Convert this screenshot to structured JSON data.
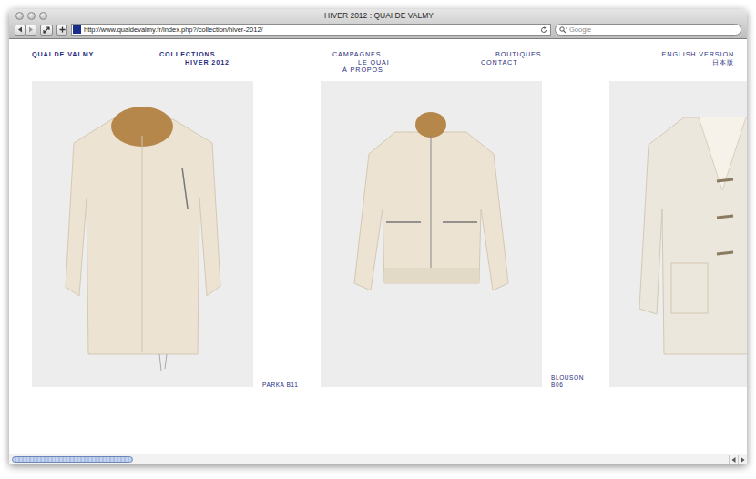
{
  "window": {
    "title": "HIVER 2012 : QUAI DE VALMY"
  },
  "toolbar": {
    "url": "http://www.quaidevalmy.fr/index.php?/collection/hiver-2012/"
  },
  "search": {
    "placeholder": "Google"
  },
  "site": {
    "logo": "QUAI DE VALMY",
    "nav": [
      {
        "items": [
          {
            "label": "COLLECTIONS",
            "selected": false
          },
          {
            "label": "HIVER 2012",
            "selected": true
          }
        ]
      },
      {
        "items": [
          {
            "label": "CAMPAGNES",
            "selected": false
          },
          {
            "label": "LE QUAI",
            "selected": false
          },
          {
            "label": "À PROPOS",
            "selected": false
          }
        ]
      },
      {
        "items": [
          {
            "label": "BOUTIQUES",
            "selected": false
          },
          {
            "label": "CONTACT",
            "selected": false
          }
        ]
      }
    ],
    "languages": [
      "ENGLISH VERSION",
      "日本版"
    ]
  },
  "products": [
    {
      "kind": "parka",
      "label_lines": [
        "PARKA B11"
      ]
    },
    {
      "kind": "blouson",
      "label_lines": [
        "BLOUSON",
        "B06"
      ]
    },
    {
      "kind": "duffle",
      "label_lines": []
    }
  ],
  "scrollbar": {
    "level": 0.17
  }
}
